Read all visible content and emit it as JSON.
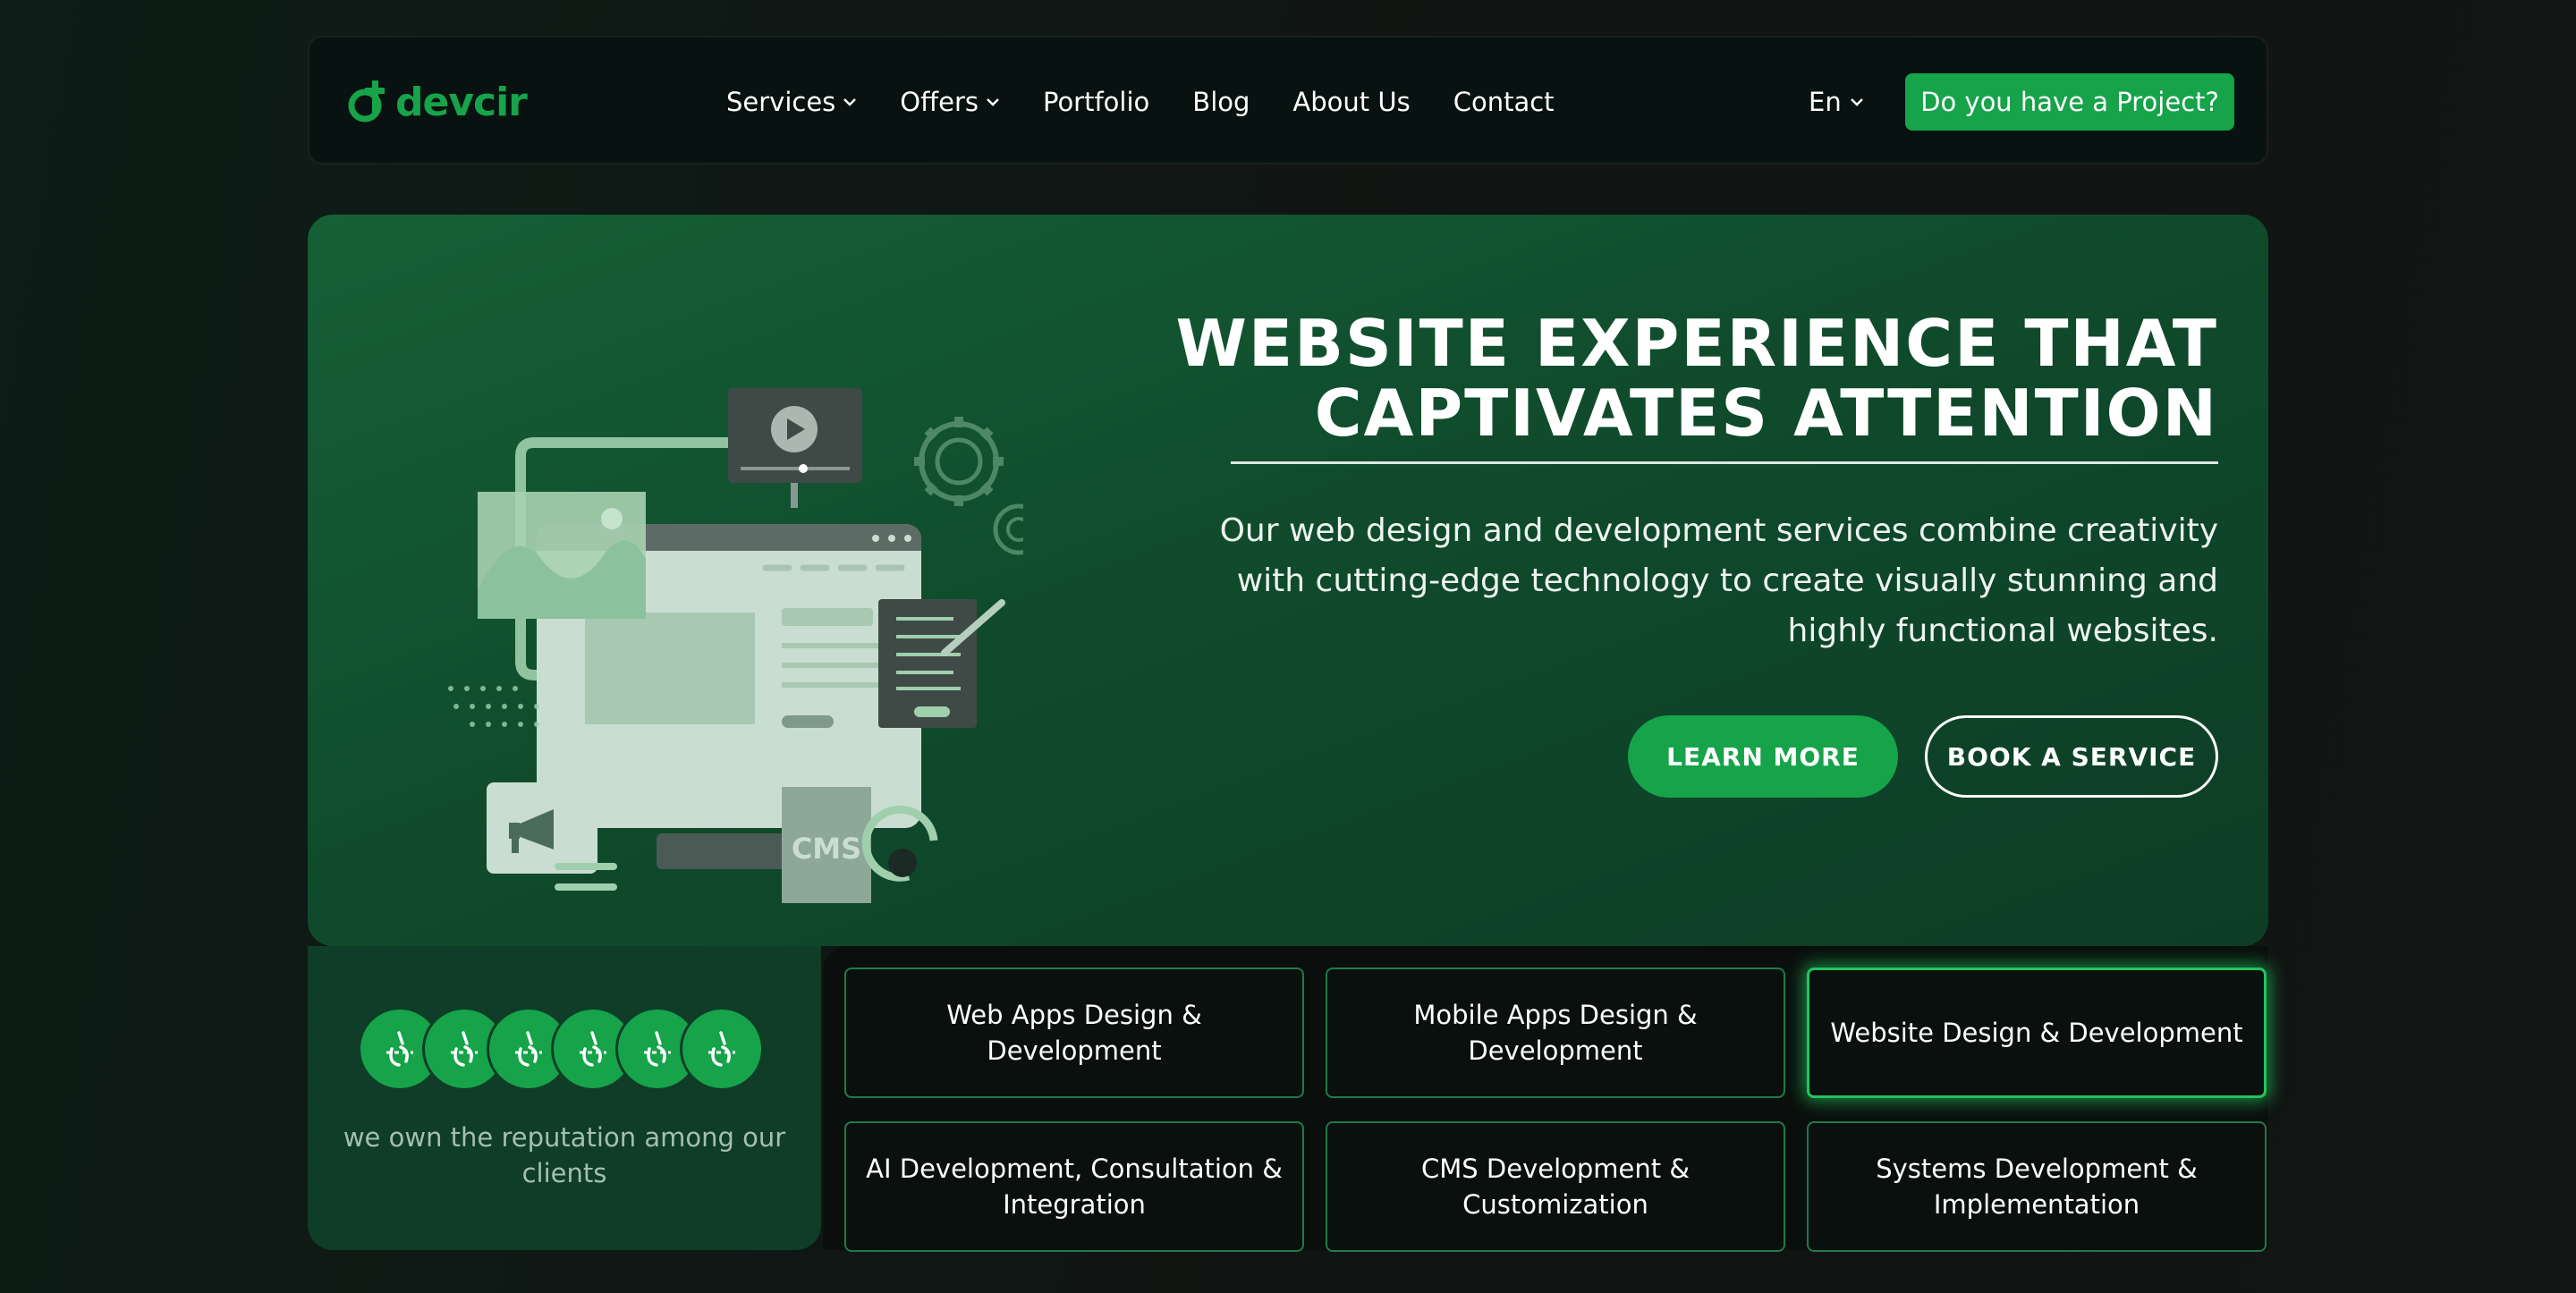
{
  "nav": {
    "logo_text": "devcir",
    "items": [
      {
        "label": "Services",
        "dropdown": true
      },
      {
        "label": "Offers",
        "dropdown": true
      },
      {
        "label": "Portfolio",
        "dropdown": false
      },
      {
        "label": "Blog",
        "dropdown": false
      },
      {
        "label": "About Us",
        "dropdown": false
      },
      {
        "label": "Contact",
        "dropdown": false
      }
    ],
    "language": "En",
    "cta_label": "Do you have a Project?"
  },
  "hero": {
    "title_line1": "WEBSITE EXPERIENCE THAT",
    "title_line2": "CAPTIVATES ATTENTION",
    "description": "Our web design and development services combine creativity with cutting-edge technology to create visually stunning and highly functional websites.",
    "learn_more_label": "LEARN MORE",
    "book_label": "BOOK A SERVICE",
    "illustration_label": "CMS"
  },
  "reputation": {
    "text": "we own the reputation among our clients",
    "avatar_count": 6
  },
  "services": [
    {
      "label": "Web Apps Design & Development",
      "active": false
    },
    {
      "label": "Mobile Apps Design & Development",
      "active": false
    },
    {
      "label": "Website Design & Development",
      "active": true
    },
    {
      "label": "AI Development, Consultation & Integration",
      "active": false
    },
    {
      "label": "CMS Development & Customization",
      "active": false
    },
    {
      "label": "Systems Development & Implementation",
      "active": false
    }
  ],
  "colors": {
    "accent": "#16a34a",
    "hero_bg": "#12512f",
    "page_bg": "#101412"
  },
  "icons": [
    "devcir-logo-icon",
    "chevron-down-icon",
    "play-icon",
    "gear-icon",
    "megaphone-icon",
    "image-icon",
    "pencil-icon"
  ]
}
